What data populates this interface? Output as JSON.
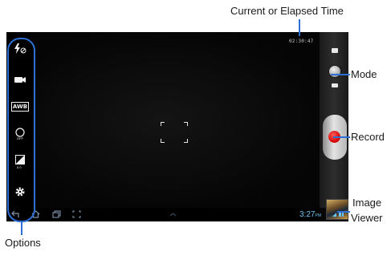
{
  "viewfinder": {
    "timer": "02:30:47"
  },
  "options": [
    {
      "name": "flash-icon",
      "label": "Flash"
    },
    {
      "name": "shooting-mode-icon",
      "label": "Shooting mode"
    },
    {
      "name": "white-balance-icon",
      "text": "AWB"
    },
    {
      "name": "timer-off-icon",
      "text": "OFF"
    },
    {
      "name": "exposure-icon",
      "text": "0.0"
    },
    {
      "name": "settings-gear-icon",
      "label": "Settings"
    }
  ],
  "statusbar": {
    "time": "3:27",
    "ampm": "PM"
  },
  "callouts": {
    "time": "Current or Elapsed Time",
    "mode": "Mode",
    "record": "Record",
    "image_viewer_1": "Image",
    "image_viewer_2": "Viewer",
    "options": "Options"
  },
  "colors": {
    "callout": "#2d6fd4",
    "record": "#d00000",
    "clock": "#6cc3ee"
  }
}
